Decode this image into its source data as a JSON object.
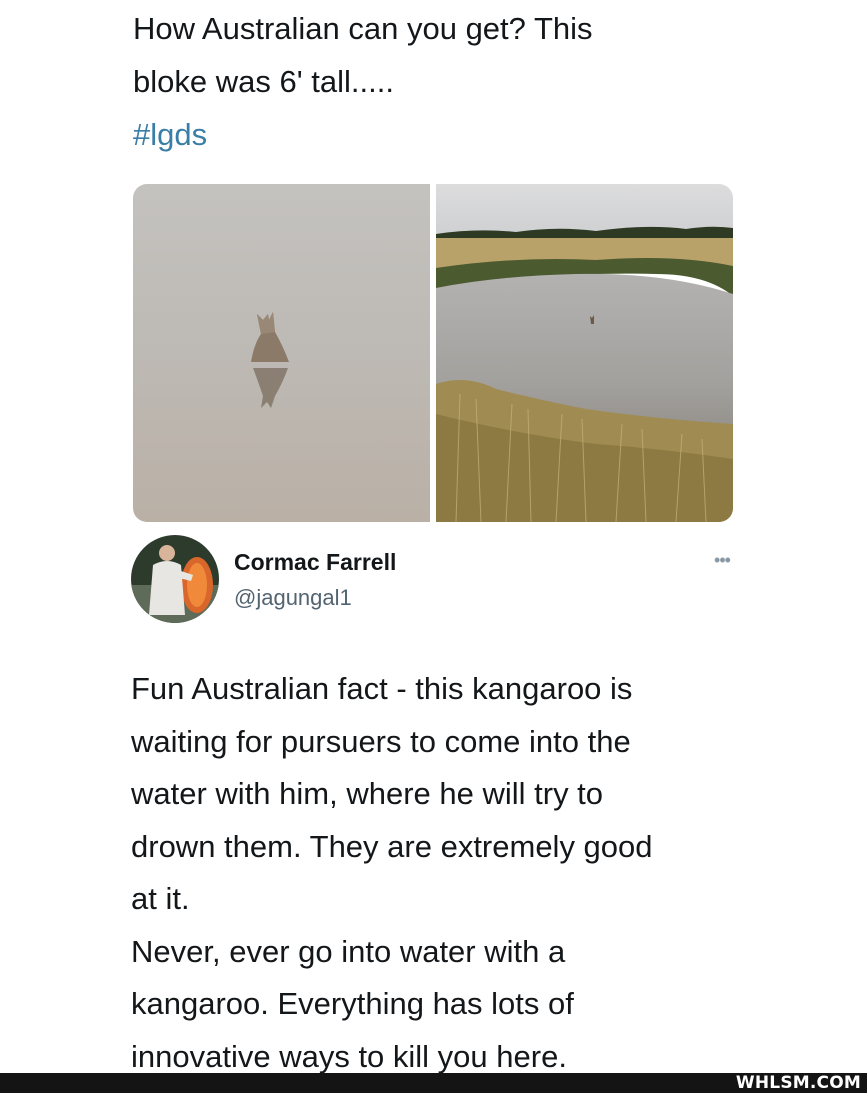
{
  "caption": {
    "line1": "How Australian can you get? This",
    "line2": "bloke was 6' tall.....",
    "hashtag": "#lgds"
  },
  "photos": [
    {
      "icon": "kangaroo-in-water-closeup"
    },
    {
      "icon": "kangaroo-in-dam-landscape"
    }
  ],
  "tweet": {
    "author_name": "Cormac Farrell",
    "author_handle": "@jagungal1",
    "more_label": "•••",
    "lines": [
      "Fun Australian fact - this kangaroo is",
      "waiting for pursuers to come into the",
      "water with him, where he will try to",
      "drown them.  They are extremely good",
      "at it.",
      "Never, ever go into water with a",
      "kangaroo.  Everything has lots of",
      "innovative ways to kill you here."
    ]
  },
  "watermark": "WHLSM.COM",
  "colors": {
    "hashtag": "#3a7ea8",
    "handle": "#536471",
    "text": "#14171a",
    "footer": "#141414"
  }
}
